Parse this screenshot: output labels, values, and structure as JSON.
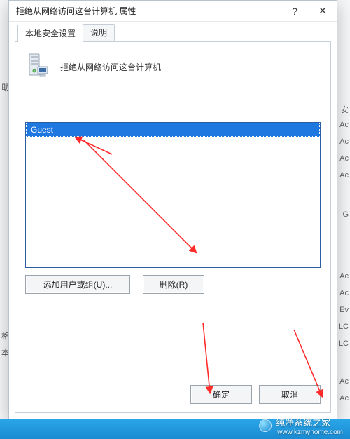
{
  "dialog": {
    "title": "拒绝从网络访问这台计算机 属性",
    "help_label": "?",
    "close_label": "✕"
  },
  "tabs": {
    "local": "本地安全设置",
    "explain": "说明"
  },
  "policy": {
    "title": "拒绝从网络访问这台计算机"
  },
  "list": {
    "items": [
      {
        "label": "Guest",
        "selected": true
      }
    ]
  },
  "buttons": {
    "add": "添加用户或组(U)...",
    "remove": "删除(R)",
    "ok": "确定",
    "cancel": "取消"
  },
  "watermark": {
    "name": "纯净系统之家",
    "url": "www.kzmyhome.com"
  },
  "bg_right_fragments": {
    "a": "安",
    "b": "Ac",
    "c": "Ac",
    "d": "Ac",
    "e": "Ac",
    "f": "G",
    "g": "Ac",
    "h": "Ac",
    "i": "Ev",
    "j": "LC",
    "k": "LC",
    "l": "Ac",
    "m": "Ac"
  },
  "bg_left_fragments": {
    "a": "助",
    "b": "格",
    "c": "本"
  }
}
